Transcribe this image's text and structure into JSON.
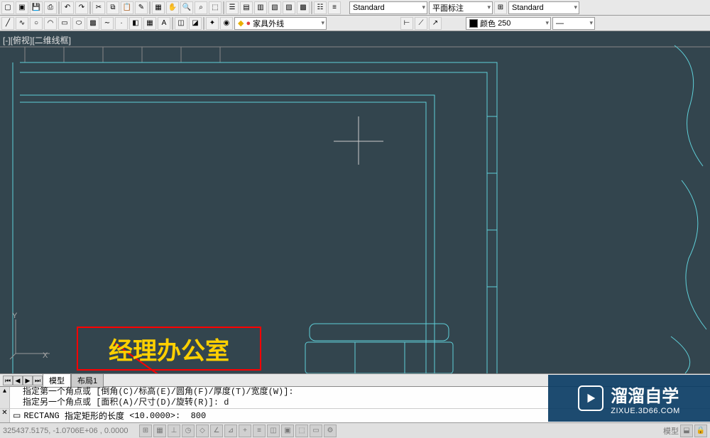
{
  "dropdowns": {
    "textStyle": "Standard",
    "dimStyle": "平面标注",
    "tableStyle": "Standard",
    "layer": "家具外线",
    "colorLabel": "颜色",
    "colorValue": "250"
  },
  "viewLabel": "[-][俯视][二维线框]",
  "ucs": {
    "x": "X",
    "y": "Y"
  },
  "roomLabel": "经理办公室",
  "tabs": {
    "model": "模型",
    "layout1": "布局1"
  },
  "command": {
    "history1": "指定第一个角点或 [倒角(C)/标高(E)/圆角(F)/厚度(T)/宽度(W)]:",
    "history2": "指定另一个角点或 [面积(A)/尺寸(D)/旋转(R)]: d",
    "promptCmd": "RECTANG",
    "promptText": "指定矩形的长度",
    "promptDefault": "<10.0000>:",
    "input": "800"
  },
  "status": {
    "coord": "325437.5175, -1.0706E+06 , 0.0000",
    "right": "模型"
  },
  "brand": {
    "title": "溜溜自学",
    "sub": "ZIXUE.3D66.COM"
  }
}
